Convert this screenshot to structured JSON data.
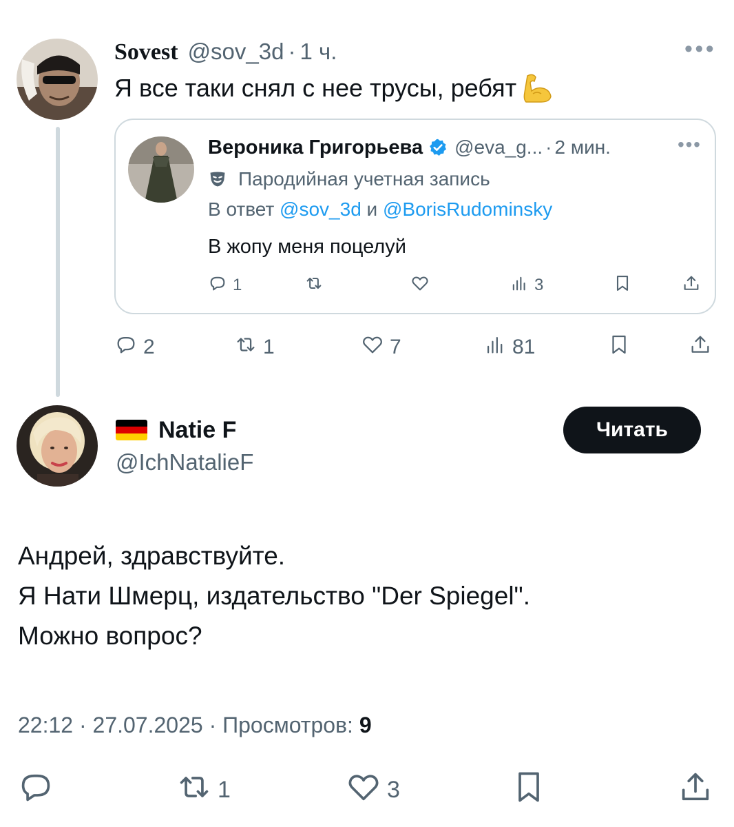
{
  "colors": {
    "text_primary": "#0f1419",
    "text_secondary": "#536471",
    "link": "#1d9bf0",
    "border": "#cfd9de",
    "follow_button_bg": "#0f1419",
    "follow_button_text": "#ffffff",
    "verified": "#1d9bf0"
  },
  "parent_tweet": {
    "author_name": "Sovest",
    "handle": "@sov_3d",
    "separator": "·",
    "time": "1 ч.",
    "more_icon": "more-horizontal-icon",
    "text": "Я все таки снял с нее трусы, ребят",
    "emoji": "flexed-biceps-emoji",
    "quote": {
      "author_name": "Вероника Григорьева",
      "verified_icon": "verified-badge-icon",
      "handle": "@eva_g...",
      "separator": "·",
      "time": "2 мин.",
      "parody_icon": "theater-mask-icon",
      "parody_label": "Пародийная учетная запись",
      "reply_prefix": "В ответ",
      "reply_user1": "@sov_3d",
      "reply_conj": "и",
      "reply_user2": "@BorisRudominsky",
      "text": "В жопу меня поцелуй",
      "actions": {
        "replies": "1",
        "reposts": "",
        "likes": "",
        "views": "3"
      }
    },
    "actions": {
      "replies": "2",
      "reposts": "1",
      "likes": "7",
      "views": "81"
    }
  },
  "main_tweet": {
    "flag": "germany-flag",
    "author_name": "Natie F",
    "handle": "@IchNatalieF",
    "follow_label": "Читать",
    "body_lines": [
      "Андрей, здравствуйте.",
      "Я Нати Шмерц, издательство \"Der Spiegel\".",
      "Можно вопрос?"
    ],
    "meta": {
      "time": "22:12",
      "sep1": "·",
      "date": "27.07.2025",
      "sep2": "·",
      "views_label": "Просмотров:",
      "views_count": "9"
    },
    "actions": {
      "replies": "",
      "reposts": "1",
      "likes": "3"
    }
  }
}
